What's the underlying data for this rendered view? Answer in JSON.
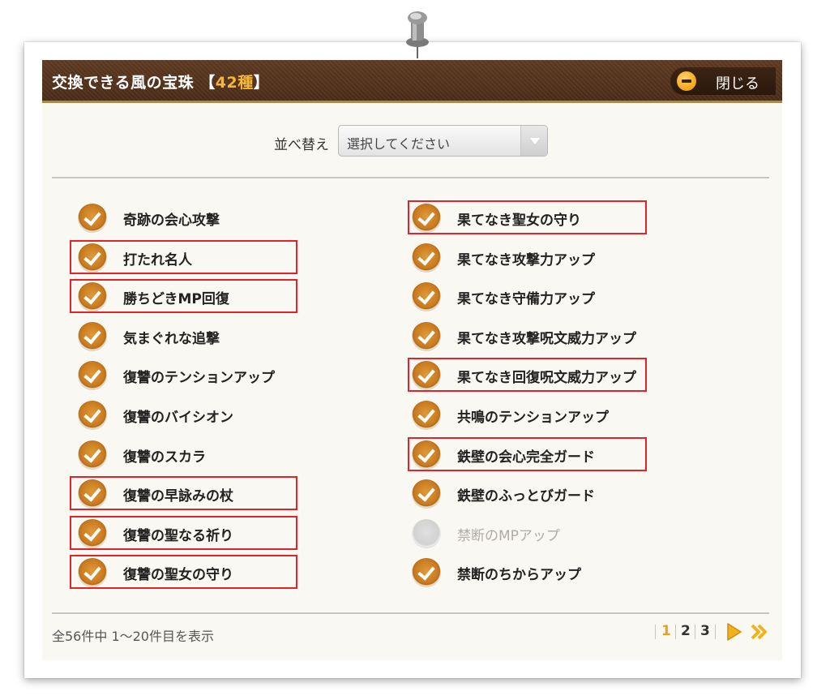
{
  "dialog": {
    "title": "交換できる風の宝珠",
    "bracket_open": "【",
    "count": "42種",
    "bracket_close": "】",
    "close_label": "閉じる"
  },
  "sort": {
    "label": "並べ替え",
    "selected": "選択してください"
  },
  "items_left": [
    {
      "label": "奇跡の会心攻撃",
      "checked": true,
      "highlighted": false
    },
    {
      "label": "打たれ名人",
      "checked": true,
      "highlighted": true
    },
    {
      "label": "勝ちどきMP回復",
      "checked": true,
      "highlighted": true
    },
    {
      "label": "気まぐれな追撃",
      "checked": true,
      "highlighted": false
    },
    {
      "label": "復讐のテンションアップ",
      "checked": true,
      "highlighted": false
    },
    {
      "label": "復讐のバイシオン",
      "checked": true,
      "highlighted": false
    },
    {
      "label": "復讐のスカラ",
      "checked": true,
      "highlighted": false
    },
    {
      "label": "復讐の早詠みの杖",
      "checked": true,
      "highlighted": true
    },
    {
      "label": "復讐の聖なる祈り",
      "checked": true,
      "highlighted": true
    },
    {
      "label": "復讐の聖女の守り",
      "checked": true,
      "highlighted": true
    }
  ],
  "items_right": [
    {
      "label": "果てなき聖女の守り",
      "checked": true,
      "highlighted": true
    },
    {
      "label": "果てなき攻撃力アップ",
      "checked": true,
      "highlighted": false
    },
    {
      "label": "果てなき守備力アップ",
      "checked": true,
      "highlighted": false
    },
    {
      "label": "果てなき攻撃呪文威力アップ",
      "checked": true,
      "highlighted": false
    },
    {
      "label": "果てなき回復呪文威力アップ",
      "checked": true,
      "highlighted": true
    },
    {
      "label": "共鳴のテンションアップ",
      "checked": true,
      "highlighted": false
    },
    {
      "label": "鉄壁の会心完全ガード",
      "checked": true,
      "highlighted": true
    },
    {
      "label": "鉄壁のふっとびガード",
      "checked": true,
      "highlighted": false
    },
    {
      "label": "禁断のMPアップ",
      "checked": false,
      "highlighted": false
    },
    {
      "label": "禁断のちからアップ",
      "checked": true,
      "highlighted": false
    }
  ],
  "footer": {
    "summary": "全56件中 1〜20件目を表示",
    "pages": [
      "1",
      "2",
      "3"
    ],
    "current_page": "1"
  },
  "colors": {
    "header_brown": "#4a2c18",
    "accent_orange": "#f7b634",
    "highlight_red": "#e0242a",
    "check_orange": "#c97a1e"
  },
  "icons": {
    "pin": "pushpin-icon",
    "close": "minus-circle-icon",
    "check": "check-circle-icon",
    "next": "next-page-icon",
    "last": "last-page-icon"
  }
}
